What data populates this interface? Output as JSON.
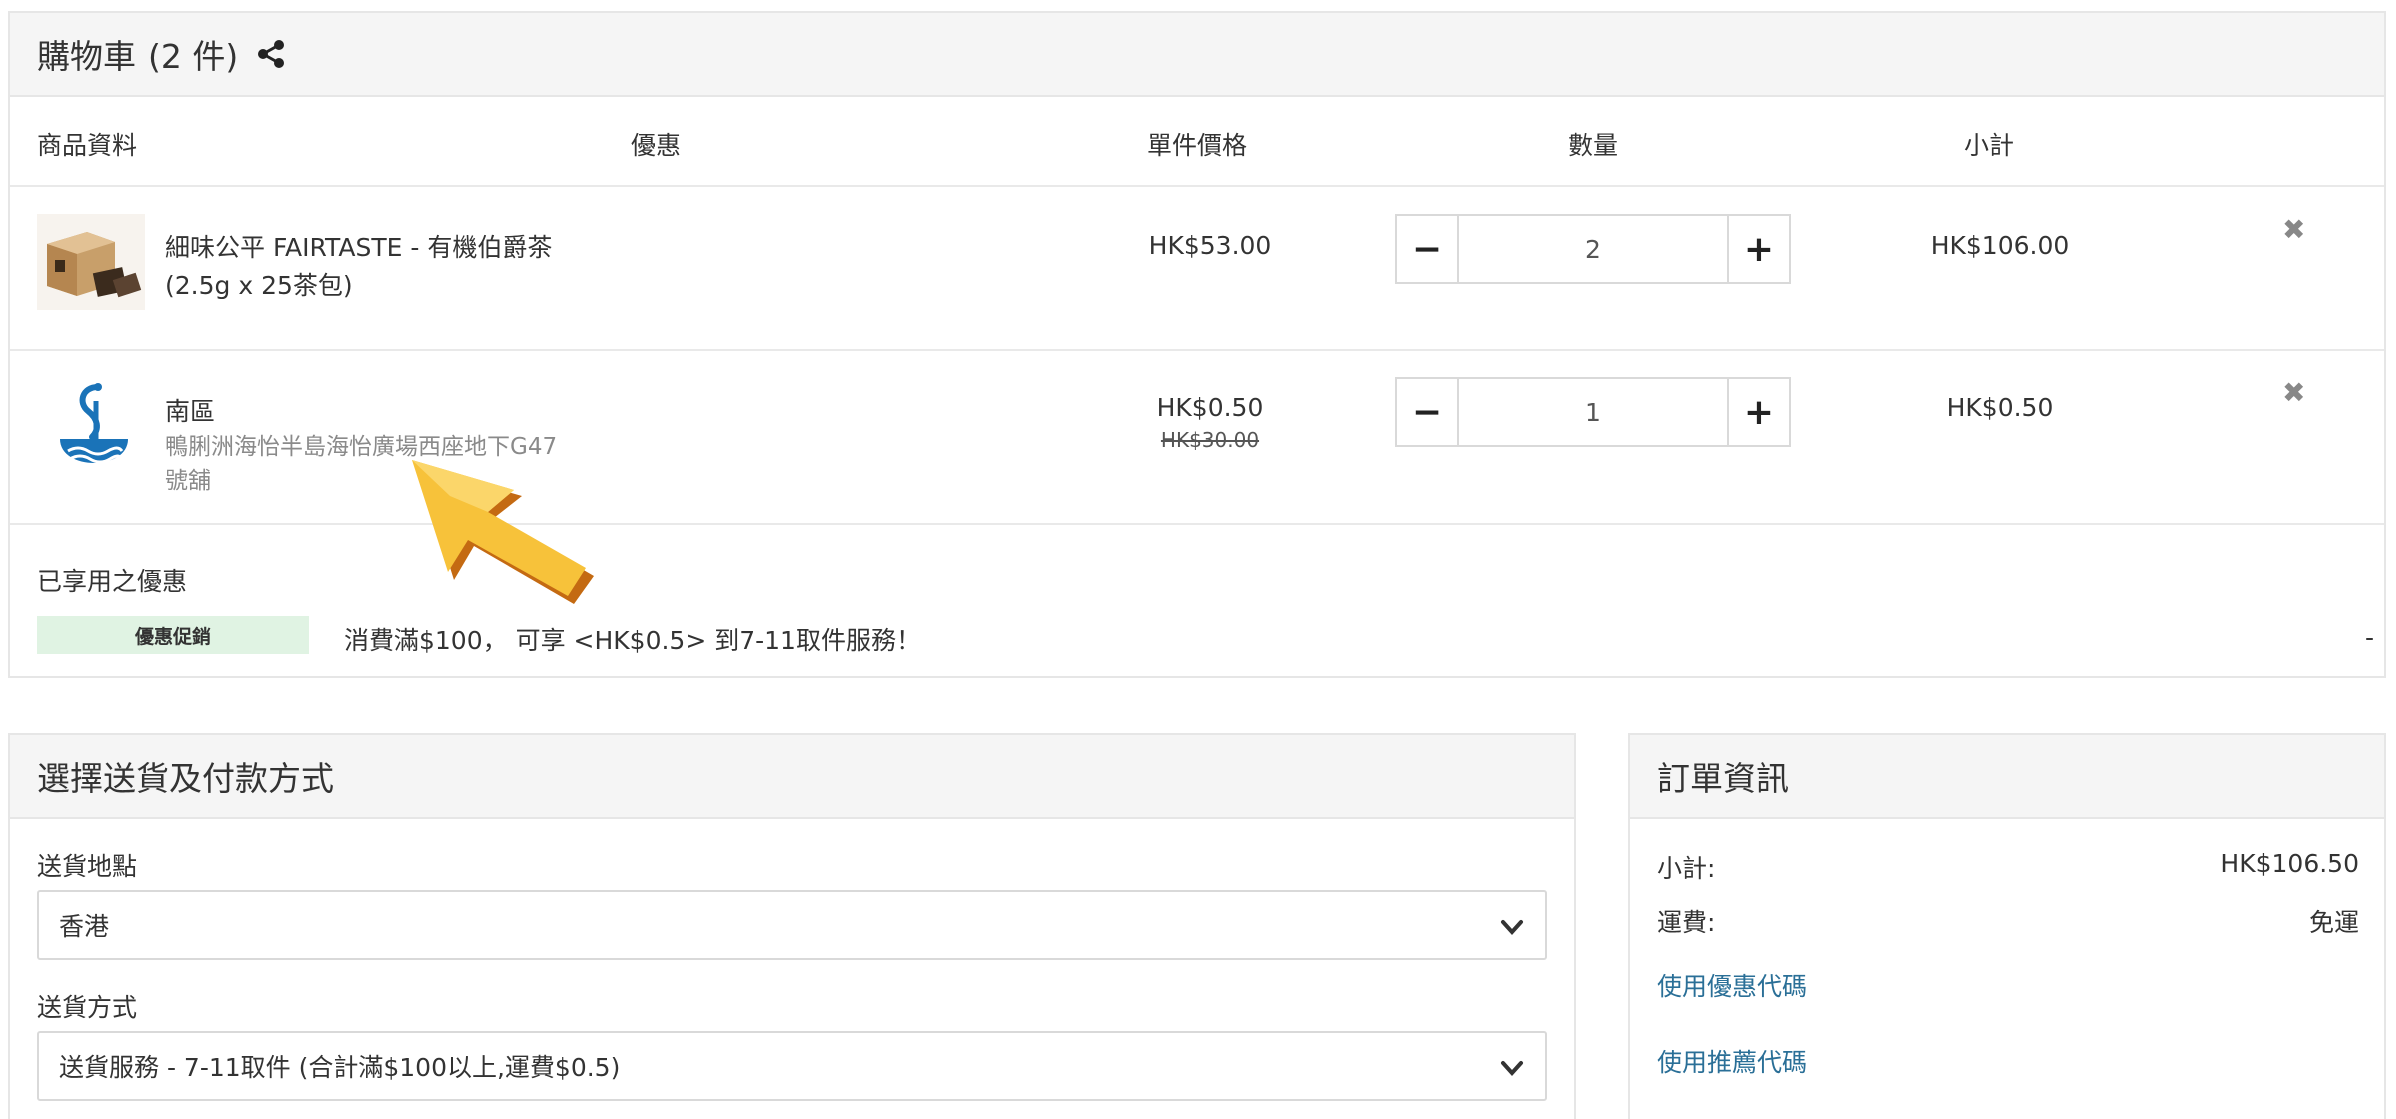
{
  "cart": {
    "title": "購物車",
    "count": "(2 件)",
    "columns": {
      "product": "商品資料",
      "discount": "優惠",
      "unit_price": "單件價格",
      "quantity": "數量",
      "subtotal": "小計"
    },
    "items": [
      {
        "name_line1": "細味公平 FAIRTASTE - 有機伯爵茶",
        "name_line2": "(2.5g x 25茶包)",
        "price": "HK$53.00",
        "quantity": "2",
        "subtotal": "HK$106.00"
      },
      {
        "name_line1": "南區",
        "sub_line1": "鴨脷洲海怡半島海怡廣場西座地下G47",
        "sub_line2": "號舖",
        "price": "HK$0.50",
        "old_price": "HK$30.00",
        "quantity": "1",
        "subtotal": "HK$0.50"
      }
    ],
    "promotions": {
      "heading": "已享用之優惠",
      "badge": "優惠促銷",
      "description": "消費滿$100， 可享 <HK$0.5> 到7-11取件服務！",
      "amount": "-"
    }
  },
  "shipping": {
    "title": "選擇送貨及付款方式",
    "location_label": "送貨地點",
    "location_value": "香港",
    "method_label": "送貨方式",
    "method_value": "送貨服務 - 7-11取件 (合計滿$100以上,運費$0.5)"
  },
  "order": {
    "title": "訂單資訊",
    "subtotal_label": "小計:",
    "subtotal_value": "HK$106.50",
    "shipping_label": "運費:",
    "shipping_value": "免運",
    "coupon_link": "使用優惠代碼",
    "referral_link": "使用推薦代碼"
  },
  "colors": {
    "link": "#2a6f97",
    "promo_badge_bg": "#e0f3e3",
    "arrow": "#f7c23a",
    "panel_header_bg": "#f5f5f5"
  }
}
